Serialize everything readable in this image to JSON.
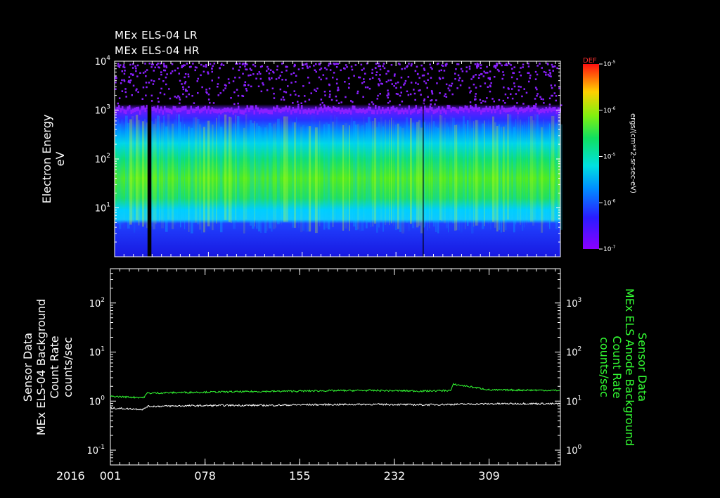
{
  "chart_data": [
    {
      "type": "heatmap",
      "title_lines": [
        "MEx ELS-04 LR",
        "MEx ELS-04 HR"
      ],
      "ylabel": [
        "Electron Energy",
        "eV"
      ],
      "y_scale": "log",
      "ylim": [
        1,
        10000
      ],
      "y_ticks": [
        {
          "base": "10",
          "exp": "4",
          "value": 10000
        },
        {
          "base": "10",
          "exp": "3",
          "value": 1000
        },
        {
          "base": "10",
          "exp": "2",
          "value": 100
        },
        {
          "base": "10",
          "exp": "1",
          "value": 10
        }
      ],
      "colorbar": {
        "label": "DEF",
        "unit_label": "ergs/(cm**2-sr-sec-eV)",
        "scale": "log",
        "ticks": [
          {
            "base": "10",
            "exp": "-5"
          },
          {
            "base": "10",
            "exp": "-6"
          },
          {
            "base": "10",
            "exp": "-5"
          },
          {
            "base": "10",
            "exp": "-6"
          },
          {
            "base": "10",
            "exp": "-7"
          }
        ]
      },
      "data_gaps_day": [
        28,
        29,
        30,
        254
      ]
    },
    {
      "type": "line",
      "xlabel_year": "2016",
      "x_ticks": [
        "001",
        "078",
        "155",
        "232",
        "309"
      ],
      "x_tick_days": [
        1,
        78,
        155,
        232,
        309
      ],
      "xlim": [
        1,
        367
      ],
      "left_axis": {
        "label": [
          "Sensor Data",
          "MEx ELS-04 Background",
          "Count Rate",
          "counts/sec"
        ],
        "scale": "log",
        "ylim": [
          0.05,
          500
        ],
        "ticks": [
          {
            "base": "10",
            "exp": "2",
            "value": 100
          },
          {
            "base": "10",
            "exp": "1",
            "value": 10
          },
          {
            "base": "10",
            "exp": "0",
            "value": 1
          },
          {
            "base": "10",
            "exp": "-1",
            "value": 0.1
          }
        ]
      },
      "right_axis": {
        "label": [
          "Sensor Data",
          "MEx ELS Anode Background",
          "Count Rate",
          "counts/sec"
        ],
        "scale": "log",
        "ylim": [
          0.5,
          5000
        ],
        "ticks": [
          {
            "base": "10",
            "exp": "3",
            "value": 1000
          },
          {
            "base": "10",
            "exp": "2",
            "value": 100
          },
          {
            "base": "10",
            "exp": "1",
            "value": 10
          },
          {
            "base": "10",
            "exp": "0",
            "value": 1
          }
        ]
      },
      "series": [
        {
          "axis": "left",
          "color": "#ffffff",
          "x": [
            1,
            28,
            31,
            60,
            100,
            130,
            155,
            180,
            210,
            240,
            254,
            280,
            310,
            340,
            367
          ],
          "y": [
            0.72,
            0.68,
            0.78,
            0.8,
            0.82,
            0.82,
            0.84,
            0.85,
            0.86,
            0.85,
            0.84,
            0.86,
            0.88,
            0.89,
            0.88
          ]
        },
        {
          "axis": "right",
          "color": "#33ff33",
          "x": [
            1,
            28,
            31,
            60,
            100,
            130,
            155,
            180,
            210,
            240,
            254,
            278,
            280,
            310,
            340,
            367
          ],
          "y": [
            12.5,
            11.8,
            14.5,
            15.0,
            15.5,
            15.8,
            16.0,
            16.3,
            16.5,
            16.2,
            16.0,
            16.5,
            22,
            16.8,
            16.8,
            16.5
          ]
        }
      ]
    }
  ]
}
